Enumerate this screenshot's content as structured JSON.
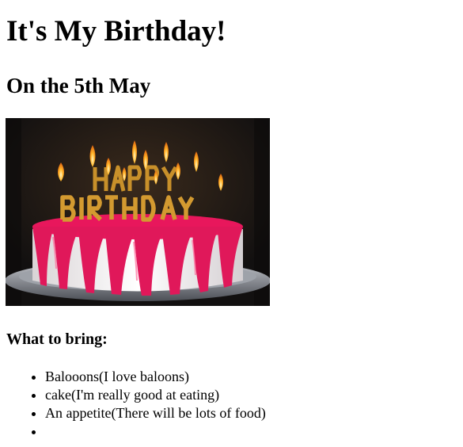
{
  "heading": {
    "title": "It's My Birthday!",
    "date": "On the 5th May"
  },
  "image": {
    "subject": "birthday-cake-photo",
    "candle_lettering": "HAPPY BIRTHDAY",
    "colors": {
      "background": "#1a1512",
      "frosting": "#f2eef0",
      "drip": "#e0185a",
      "plate": "#8a8e96",
      "letters": "#c8902a",
      "flame": "#ffb020"
    }
  },
  "bring": {
    "heading": "What to bring:",
    "items": [
      "Balooons(I love baloons)",
      "cake(I'm really good at eating)",
      "An appetite(There will be lots of food)",
      ""
    ]
  }
}
